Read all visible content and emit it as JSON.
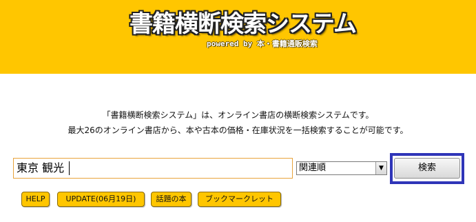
{
  "header": {
    "title": "書籍横断検索システム",
    "powered_by": "powered by 本・書籍通販検索"
  },
  "description": {
    "line1": "「書籍横断検索システム」は、オンライン書店の横断検索システムです。",
    "line2": "最大26のオンライン書店から、本や古本の価格・在庫状況を一括検索することが可能です。"
  },
  "search": {
    "query": "東京 観光",
    "sort_selected": "関連順",
    "button_label": "検索"
  },
  "links": {
    "help": "HELP",
    "update": "UPDATE(06月19日)",
    "topic": "話題の本",
    "bookmarklet": "ブックマークレット"
  },
  "colors": {
    "header_bg": "#FFC600",
    "highlight": "#2F35B8",
    "input_border": "#E8A33B"
  }
}
